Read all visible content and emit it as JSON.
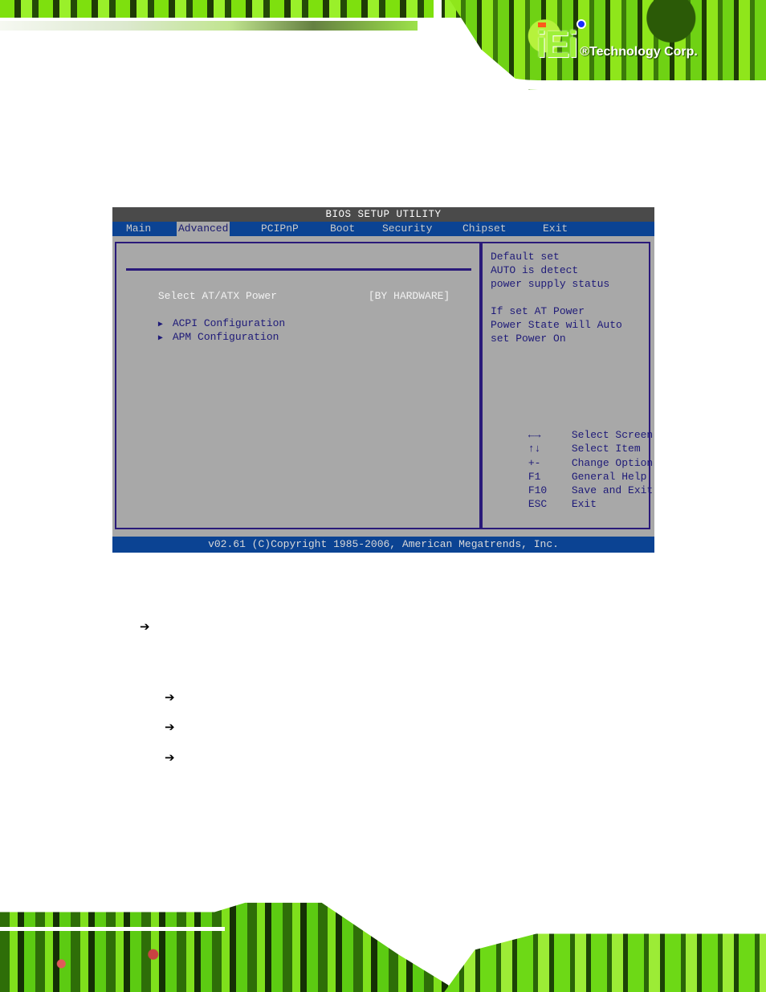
{
  "branding": {
    "logo_mark": "iEi",
    "logo_tagline": "®Technology Corp."
  },
  "bios": {
    "title": "BIOS SETUP UTILITY",
    "menu_tabs": [
      {
        "label": "Main",
        "active": false
      },
      {
        "label": "Advanced",
        "active": true
      },
      {
        "label": "PCIPnP",
        "active": false
      },
      {
        "label": "Boot",
        "active": false
      },
      {
        "label": "Security",
        "active": false
      },
      {
        "label": "Chipset",
        "active": false
      },
      {
        "label": "Exit",
        "active": false
      }
    ],
    "settings": [
      {
        "label": "Select AT/ATX Power",
        "value": "[BY HARDWARE]"
      }
    ],
    "submenus": [
      {
        "icon": "submenu-triangle-icon",
        "glyph": "▶",
        "label": "ACPI Configuration"
      },
      {
        "icon": "submenu-triangle-icon",
        "glyph": "▶",
        "label": "APM Configuration"
      }
    ],
    "help_text": [
      "Default set",
      "AUTO is detect",
      "power supply status",
      "",
      "If set AT Power",
      "Power State will Auto",
      "set Power On"
    ],
    "key_legend": [
      {
        "key": "←→",
        "action": "Select Screen"
      },
      {
        "key": "↑↓",
        "action": "Select Item"
      },
      {
        "key": "+-",
        "action": "Change Option"
      },
      {
        "key": "F1",
        "action": "General Help"
      },
      {
        "key": "F10",
        "action": "Save and Exit"
      },
      {
        "key": "ESC",
        "action": "Exit"
      }
    ],
    "footer": "v02.61 (C)Copyright 1985-2006, American Megatrends, Inc.",
    "colors": {
      "title_bg": "#4a4a4a",
      "menu_bg": "#0b4393",
      "panel_bg": "#a8a8a8",
      "border": "#2a1a7a",
      "text_navy": "#1e1a78",
      "text_white": "#f2f2f2"
    }
  },
  "document": {
    "arrows": [
      {
        "icon": "right-arrow-icon",
        "glyph": "➔"
      },
      {
        "icon": "right-arrow-icon",
        "glyph": "➔"
      },
      {
        "icon": "right-arrow-icon",
        "glyph": "➔"
      },
      {
        "icon": "right-arrow-icon",
        "glyph": "➔"
      }
    ]
  }
}
